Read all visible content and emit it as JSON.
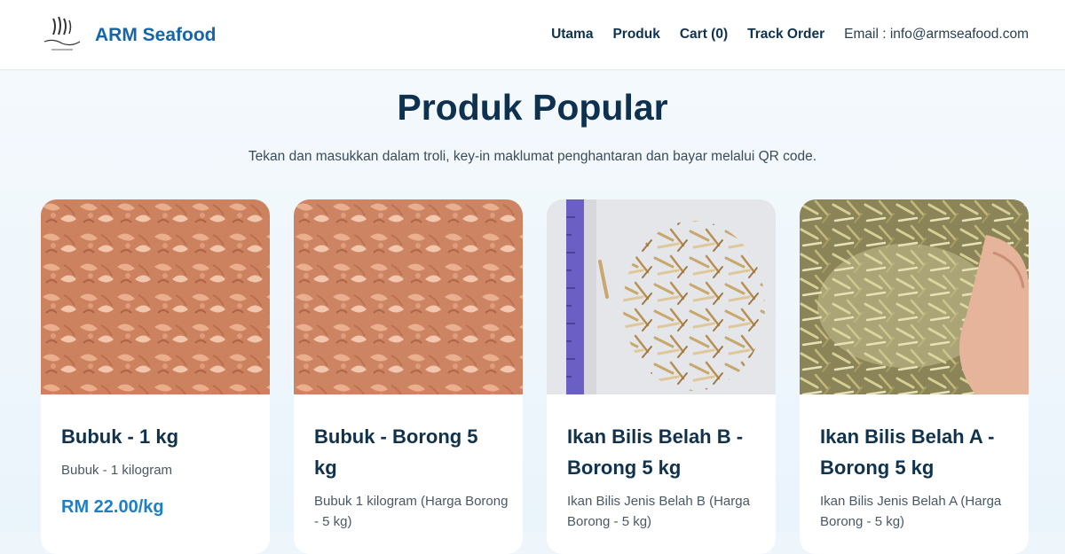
{
  "header": {
    "brand": "ARM Seafood",
    "nav": [
      "Utama",
      "Produk",
      "Cart (0)",
      "Track Order"
    ],
    "email": "Email : info@armseafood.com"
  },
  "main": {
    "title": "Produk Popular",
    "subtitle": "Tekan dan masukkan dalam troli, key-in maklumat penghantaran dan bayar melalui QR code."
  },
  "products": [
    {
      "name": "Bubuk - 1 kg",
      "desc": "Bubuk - 1 kilogram",
      "price": "RM 22.00/kg",
      "image": "dried-shrimp-photo"
    },
    {
      "name": "Bubuk - Borong 5 kg",
      "desc": "Bubuk 1 kilogram (Harga Borong - 5 kg)",
      "price": "",
      "image": "dried-shrimp-photo"
    },
    {
      "name": "Ikan Bilis Belah B - Borong 5 kg",
      "desc": "Ikan Bilis Jenis Belah B (Harga Borong - 5 kg)",
      "price": "",
      "image": "dried-anchovy-ruler-photo"
    },
    {
      "name": "Ikan Bilis Belah A - Borong 5 kg",
      "desc": "Ikan Bilis Jenis Belah A (Harga Borong - 5 kg)",
      "price": "",
      "image": "dried-anchovy-hand-photo"
    }
  ],
  "colors": {
    "brand": "#1565a8",
    "price": "#1f7fc4",
    "heading": "#0f3150"
  }
}
